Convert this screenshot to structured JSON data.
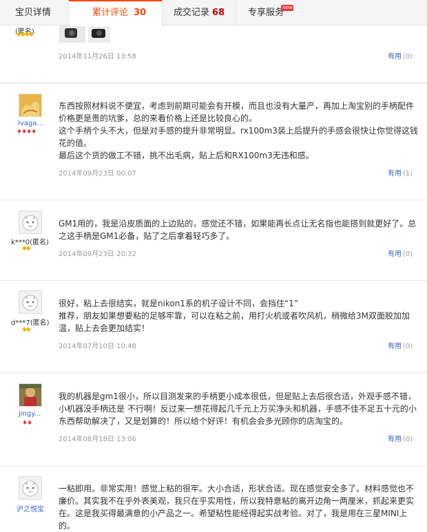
{
  "tabs": [
    {
      "label": "宝贝详情",
      "count": "",
      "badge": ""
    },
    {
      "label": "累计评论",
      "count": "30",
      "badge": ""
    },
    {
      "label": "成交记录",
      "count": "68",
      "badge": ""
    },
    {
      "label": "专享服务",
      "count": "",
      "badge": "new"
    }
  ],
  "partial_review": {
    "user": "(匿名)",
    "gems": "◆◆◆◆",
    "date": "2014年11月26日 13:58",
    "helpful_label": "有用",
    "helpful_count": "(0)"
  },
  "reviews": [
    {
      "user": "Ivaga...",
      "gems": "♦♦♦♦",
      "lines": [
        "东西按照材料说不便宜，考虑到前期可能会有开模，而且也没有大量产，再加上淘宝别的手柄配件价格更是贵的坑爹，总的来看价格上还是比较良心的。",
        "这个手柄个头不大，但是对手感的提升非常明显。rx100m3装上后提升的手感会很快让你觉得这钱花的值。",
        "最后这个货的做工不错，挑不出毛病，贴上后和RX100m3无违和感。"
      ],
      "date": "2014年09月23日 00:07",
      "helpful_label": "有用",
      "helpful_count": "(1)"
    },
    {
      "user": "k***0(匿名)",
      "gems": "◆◆",
      "lines": [
        "GM1用的，我是沿皮质面的上边贴的，感觉还不错，如果能再长点让无名指也能搭到就更好了。总之这手柄是GM1必备，贴了之后拿着轻巧多了。"
      ],
      "date": "2014年09月23日 20:32",
      "helpful_label": "有用",
      "helpful_count": "(0)"
    },
    {
      "user": "d***7(匿名)",
      "gems": "◆◆",
      "lines": [
        "很好，粘上去很结实，就是nikon1系的机子设计不同，会挡住“1”",
        "推荐，朋友如果想要粘的足够牢靠，可以在粘之前，用打火机或者吹风机，稍微给3M双面胶加加温，贴上去会更加结实！"
      ],
      "date": "2014年07月10日 10:48",
      "helpful_label": "有用",
      "helpful_count": "(0)"
    },
    {
      "user": "jingy...",
      "gems": "♦♦",
      "lines": [
        "我的机器是gm1很小，所以目测发来的手柄更小成本很低，但是贴上去后很合适，外观手感不错，小机器没手柄还是 不行啊！反过来一想花得起几千元上万买净头和机器，手感不佳不足五十元的小东西帮助解决了，又是划算的！所以给个好评！有机会会多光顾你的店淘宝的。"
      ],
      "date": "2014年08月18日 13:06",
      "helpful_label": "有用",
      "helpful_count": "(0)"
    },
    {
      "user": "沪之悦宝",
      "gems": "",
      "lines": [
        "一粘即用。非常实用！感觉上粘的很牢。大小合适，形状合适。现在感觉安全多了。材料感觉也不廉价。其实我不在乎外表美观，我只在乎实用性，所以我特意粘的离开边角一两厘米，抓起来更实在。这是我买得最满意的小产品之一。希望粘性能经得起实战考验。对了，我是用在三星MINI上的。"
      ],
      "date": "",
      "helpful_label": "",
      "helpful_count": ""
    }
  ],
  "colors": {
    "accent": "#ff4400",
    "link": "#3366cc",
    "muted": "#999999"
  }
}
